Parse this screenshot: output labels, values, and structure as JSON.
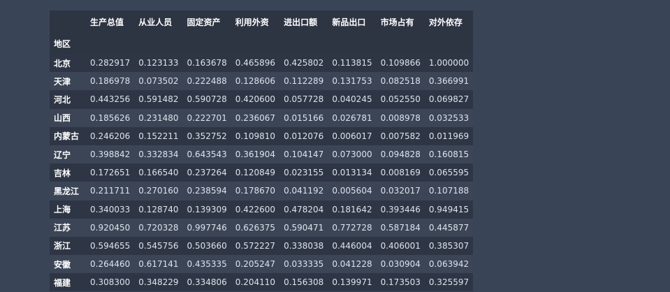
{
  "table": {
    "index_name": "地区",
    "columns": [
      "生产总值",
      "从业人员",
      "固定资产",
      "利用外资",
      "进出口额",
      "新品出口",
      "市场占有",
      "对外依存"
    ],
    "rows": [
      {
        "label": "北京",
        "values": [
          "0.282917",
          "0.123133",
          "0.163678",
          "0.465896",
          "0.425802",
          "0.113815",
          "0.109866",
          "1.000000"
        ]
      },
      {
        "label": "天津",
        "values": [
          "0.186978",
          "0.073502",
          "0.222488",
          "0.128606",
          "0.112289",
          "0.131753",
          "0.082518",
          "0.366991"
        ]
      },
      {
        "label": "河北",
        "values": [
          "0.443256",
          "0.591482",
          "0.590728",
          "0.420600",
          "0.057728",
          "0.040245",
          "0.052550",
          "0.069827"
        ]
      },
      {
        "label": "山西",
        "values": [
          "0.185626",
          "0.231480",
          "0.222701",
          "0.236067",
          "0.015166",
          "0.026781",
          "0.008978",
          "0.032533"
        ]
      },
      {
        "label": "内蒙古",
        "values": [
          "0.246206",
          "0.152211",
          "0.352752",
          "0.109810",
          "0.012076",
          "0.006017",
          "0.007582",
          "0.011969"
        ]
      },
      {
        "label": "辽宁",
        "values": [
          "0.398842",
          "0.332834",
          "0.643543",
          "0.361904",
          "0.104147",
          "0.073000",
          "0.094828",
          "0.160815"
        ]
      },
      {
        "label": "吉林",
        "values": [
          "0.172651",
          "0.166540",
          "0.237264",
          "0.120849",
          "0.023155",
          "0.013134",
          "0.008169",
          "0.065595"
        ]
      },
      {
        "label": "黑龙江",
        "values": [
          "0.211711",
          "0.270160",
          "0.238594",
          "0.178670",
          "0.041192",
          "0.005604",
          "0.032017",
          "0.107188"
        ]
      },
      {
        "label": "上海",
        "values": [
          "0.340033",
          "0.128740",
          "0.139309",
          "0.422600",
          "0.478204",
          "0.181642",
          "0.393446",
          "0.949415"
        ]
      },
      {
        "label": "江苏",
        "values": [
          "0.920450",
          "0.720328",
          "0.997746",
          "0.626375",
          "0.590471",
          "0.772728",
          "0.587184",
          "0.445877"
        ]
      },
      {
        "label": "浙江",
        "values": [
          "0.594655",
          "0.545756",
          "0.503660",
          "0.572227",
          "0.338038",
          "0.446004",
          "0.406001",
          "0.385307"
        ]
      },
      {
        "label": "安徽",
        "values": [
          "0.264460",
          "0.617141",
          "0.435335",
          "0.205247",
          "0.033335",
          "0.041228",
          "0.030904",
          "0.063942"
        ]
      },
      {
        "label": "福建",
        "values": [
          "0.308300",
          "0.348229",
          "0.334806",
          "0.204110",
          "0.156308",
          "0.139971",
          "0.173503",
          "0.325597"
        ]
      }
    ]
  }
}
